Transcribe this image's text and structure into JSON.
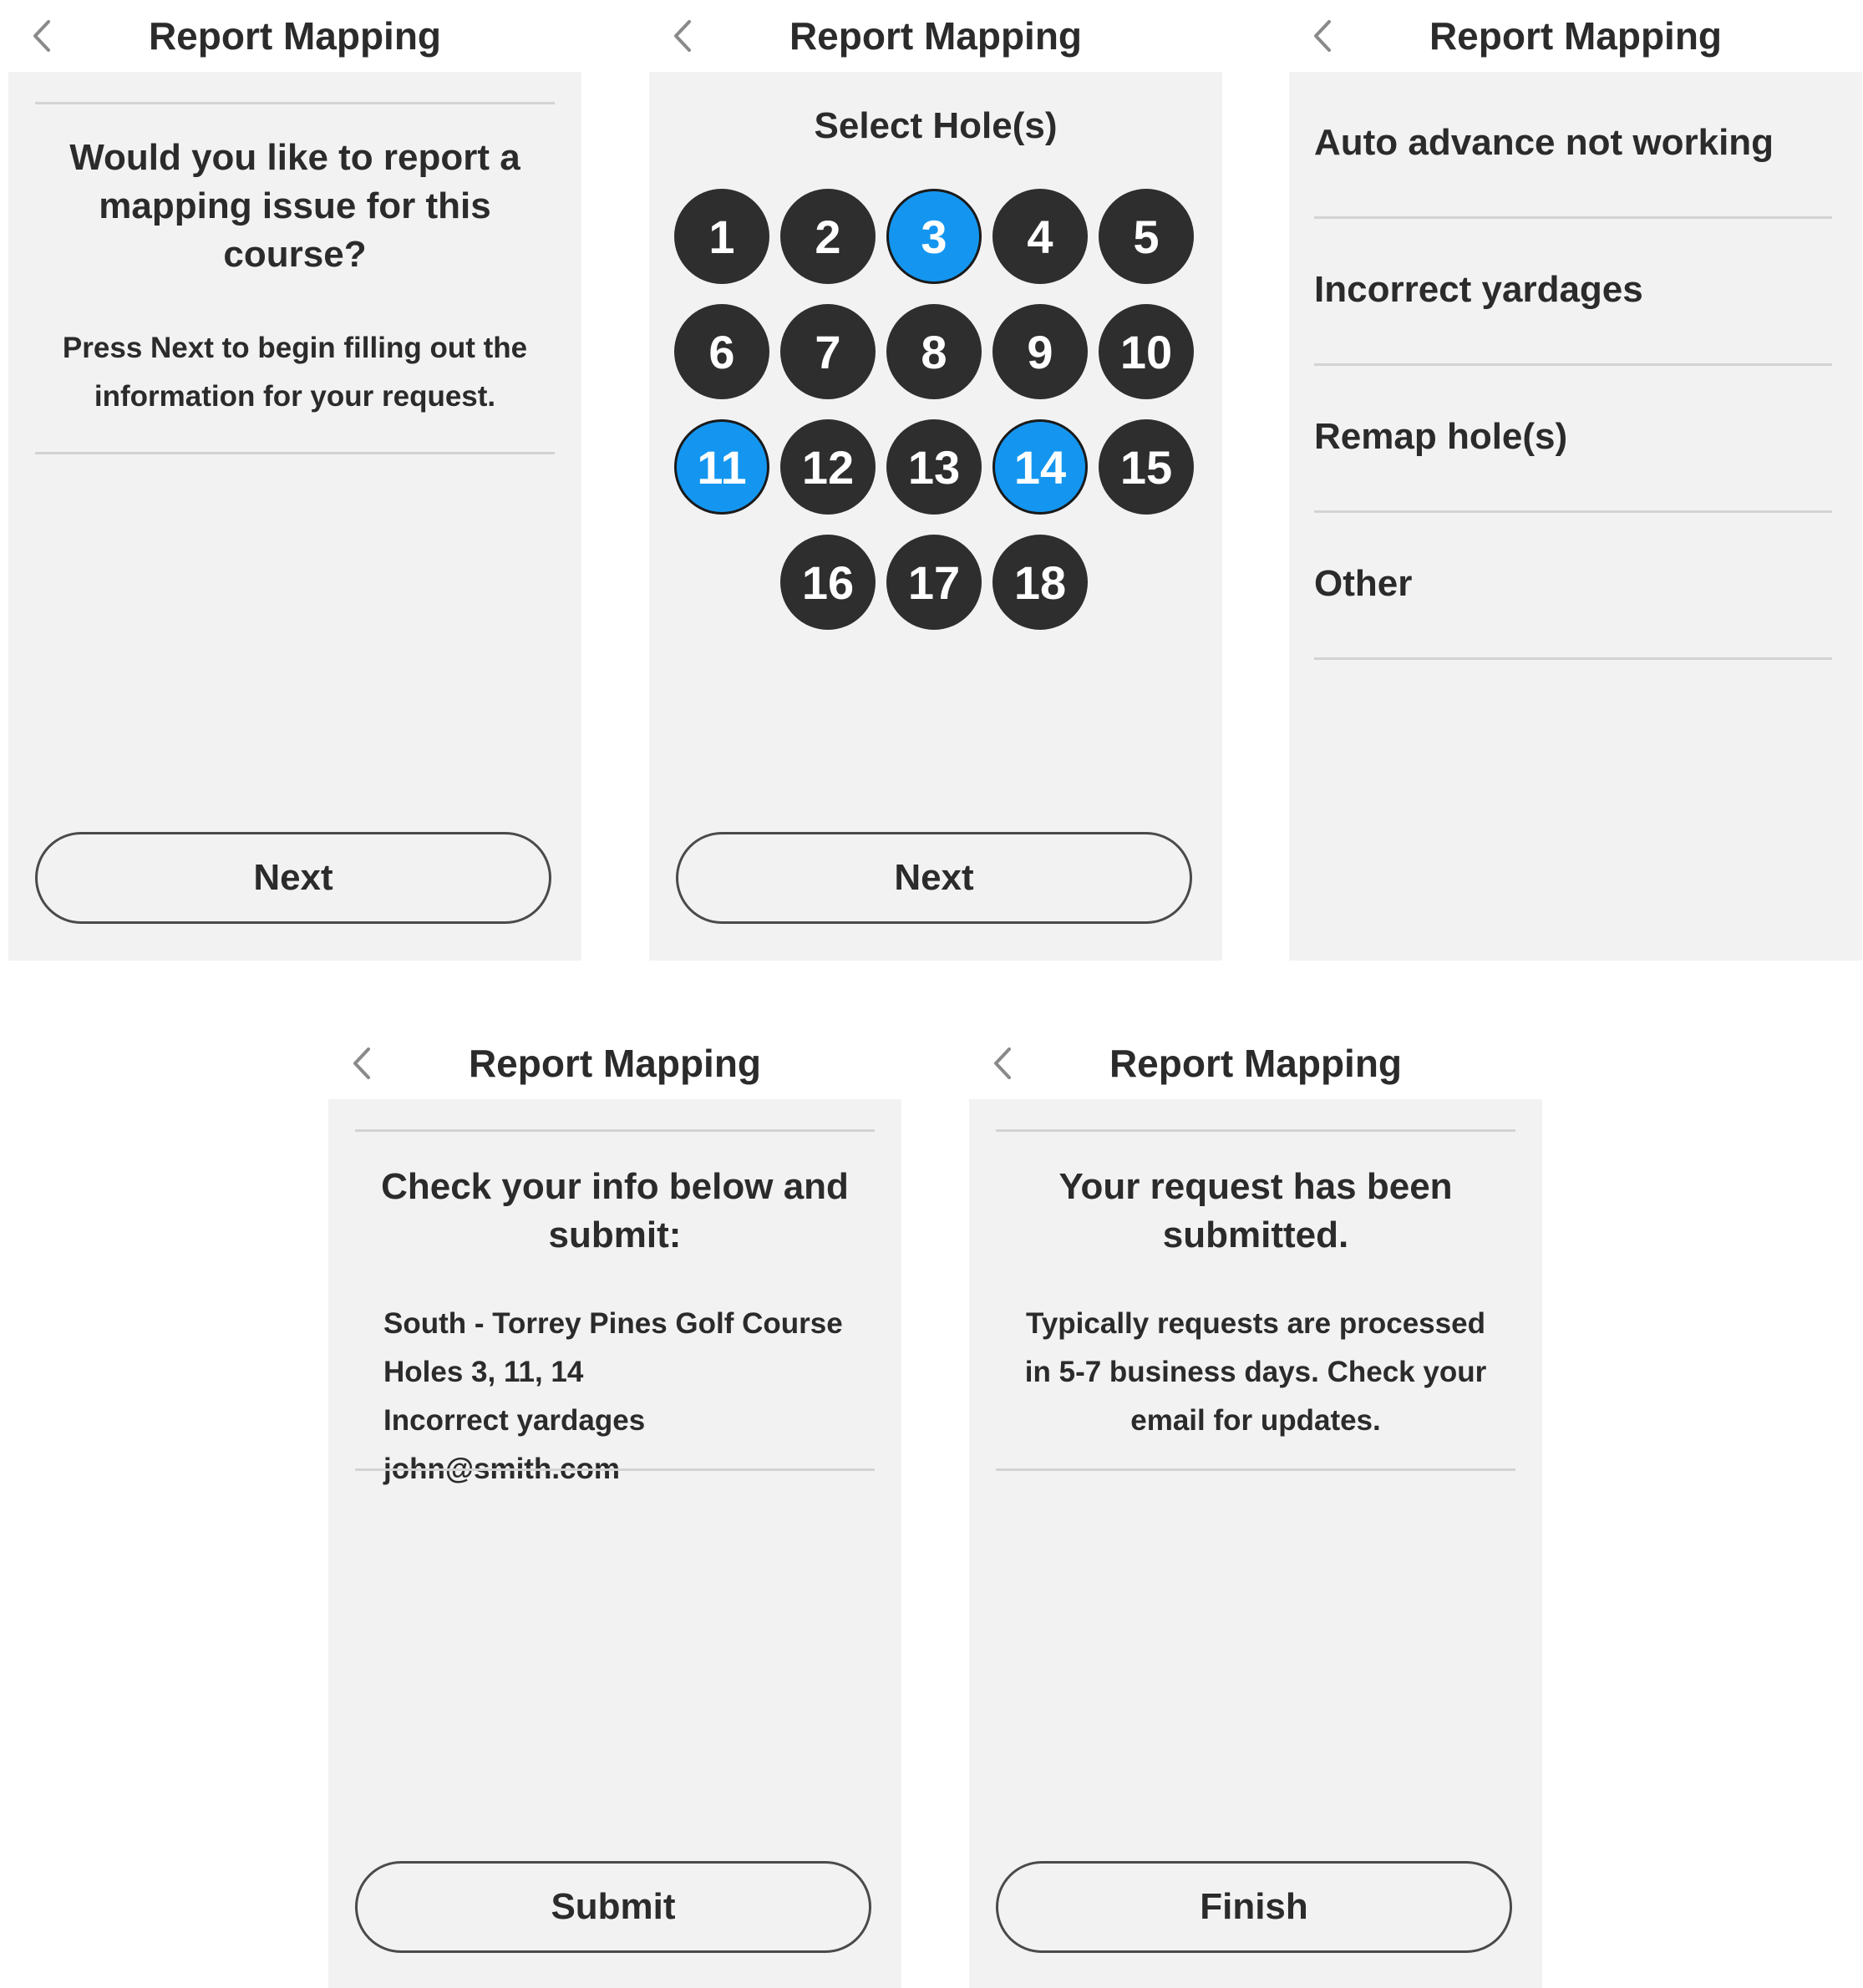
{
  "common": {
    "title": "Report Mapping"
  },
  "intro": {
    "heading": "Would you like to report a mapping issue for this course?",
    "body": "Press Next to begin filling out the information for your request.",
    "button_label": "Next"
  },
  "hole_select": {
    "heading": "Select Hole(s)",
    "holes": [
      {
        "number": "1",
        "selected": false
      },
      {
        "number": "2",
        "selected": false
      },
      {
        "number": "3",
        "selected": true
      },
      {
        "number": "4",
        "selected": false
      },
      {
        "number": "5",
        "selected": false
      },
      {
        "number": "6",
        "selected": false
      },
      {
        "number": "7",
        "selected": false
      },
      {
        "number": "8",
        "selected": false
      },
      {
        "number": "9",
        "selected": false
      },
      {
        "number": "10",
        "selected": false
      },
      {
        "number": "11",
        "selected": true
      },
      {
        "number": "12",
        "selected": false
      },
      {
        "number": "13",
        "selected": false
      },
      {
        "number": "14",
        "selected": true
      },
      {
        "number": "15",
        "selected": false
      },
      {
        "number": "16",
        "selected": false
      },
      {
        "number": "17",
        "selected": false
      },
      {
        "number": "18",
        "selected": false
      }
    ],
    "button_label": "Next"
  },
  "issue_type": {
    "options": [
      "Auto advance not working",
      "Incorrect yardages",
      "Remap hole(s)",
      "Other"
    ]
  },
  "review": {
    "heading": "Check your info below and submit:",
    "lines": [
      "South - Torrey Pines Golf Course",
      "Holes 3, 11, 14",
      "Incorrect yardages",
      "john@smith.com"
    ],
    "button_label": "Submit"
  },
  "confirmation": {
    "heading": "Your request has been submitted.",
    "body": "Typically requests are processed in 5-7 business days. Check your email for updates.",
    "button_label": "Finish"
  },
  "colors": {
    "panel_background": "#f2f2f2",
    "hole_default": "#2e2e2e",
    "hole_selected": "#1496f0",
    "text": "#2b2b2b",
    "divider": "#d3d3d3"
  },
  "icons": {
    "back": "chevron-left-icon"
  }
}
